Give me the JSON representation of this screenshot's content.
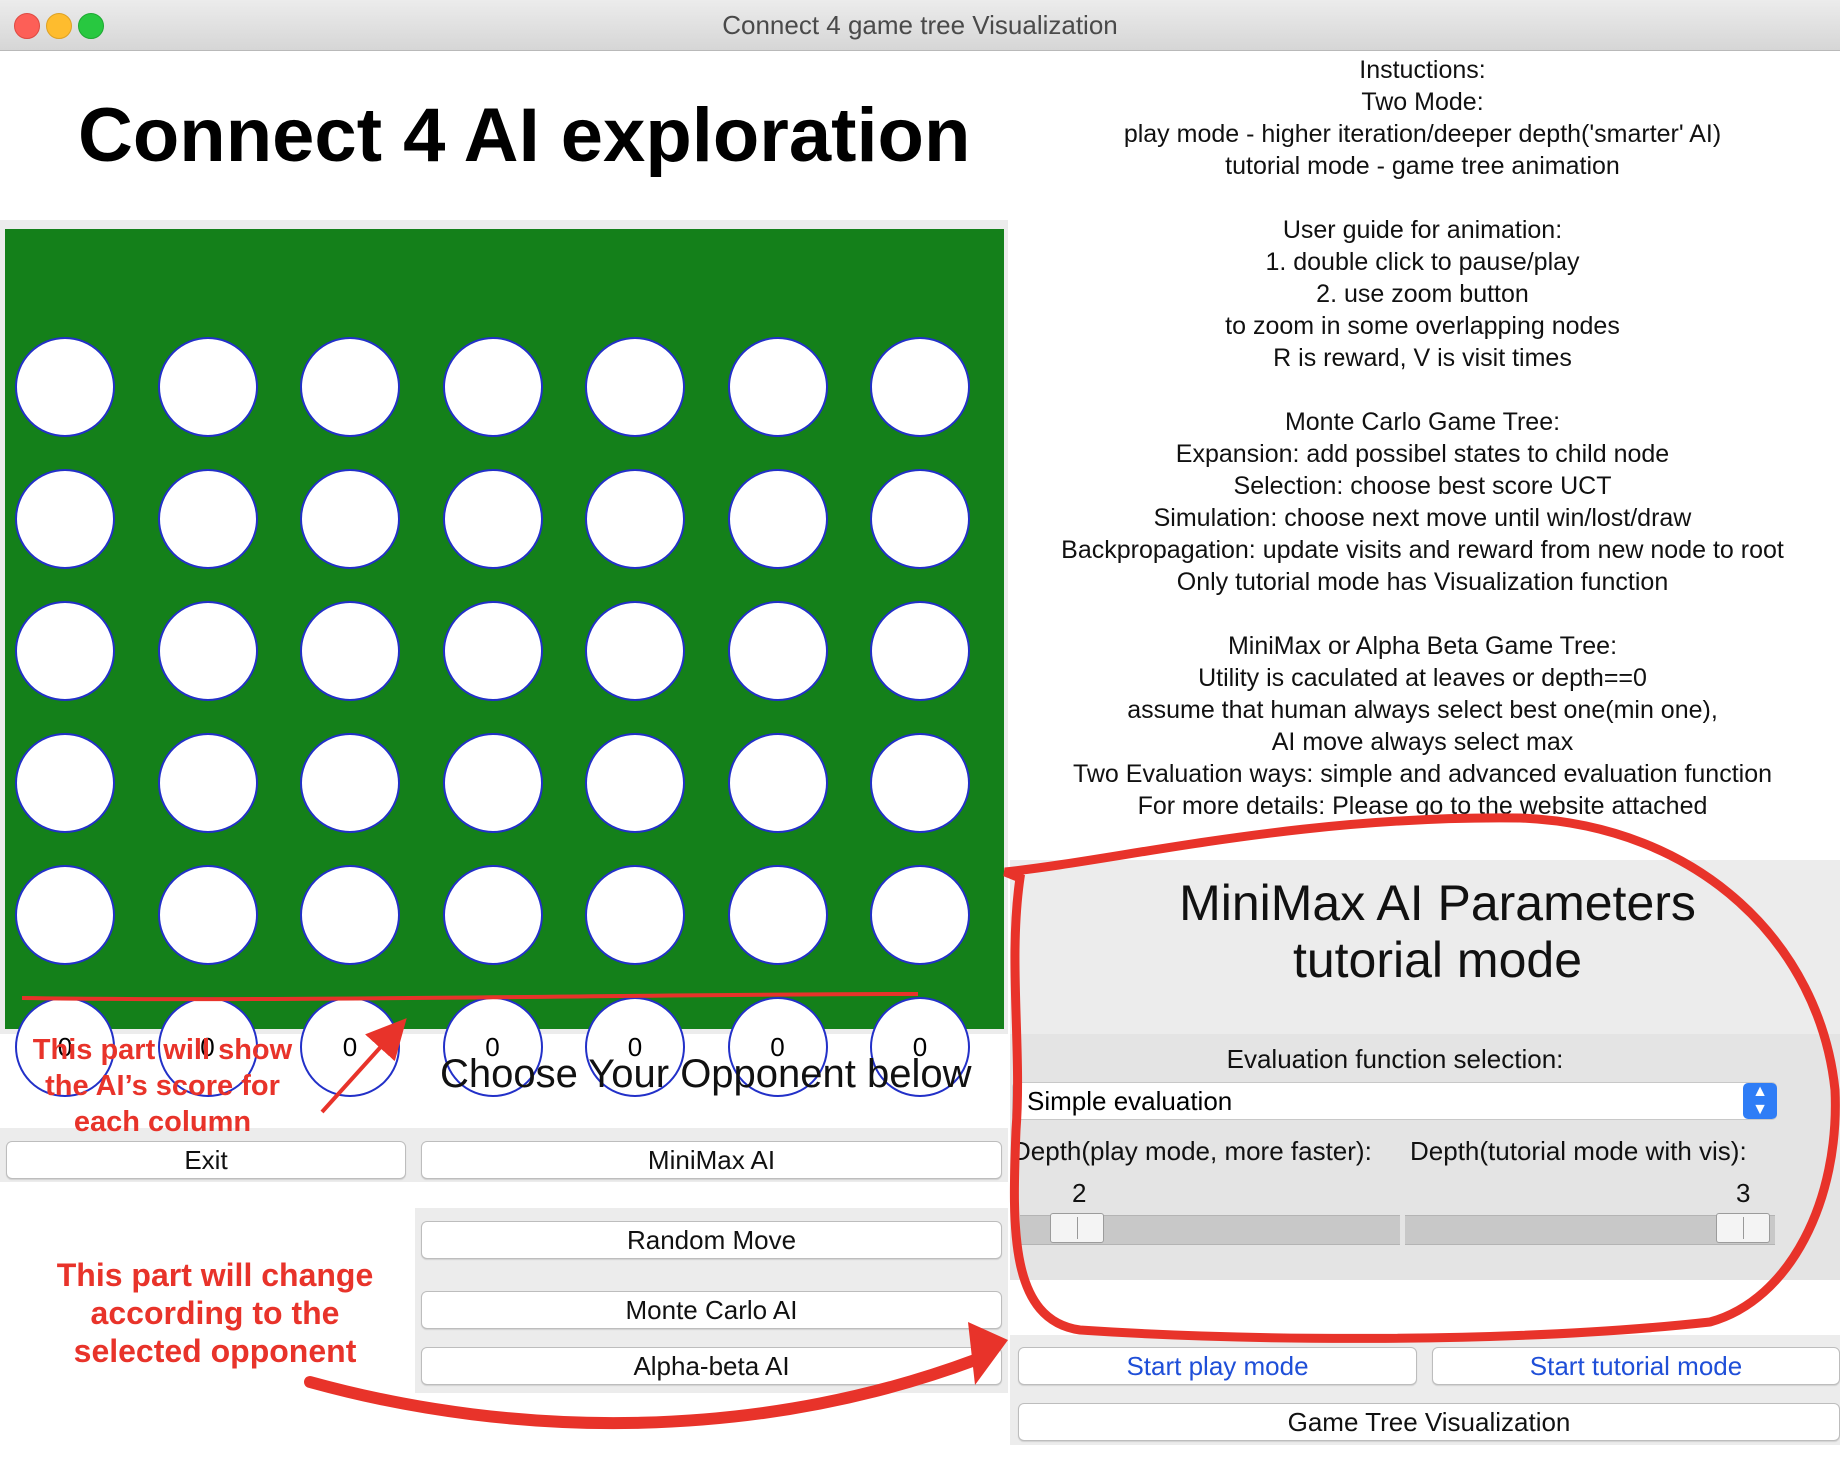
{
  "window": {
    "title": "Connect 4 game tree Visualization"
  },
  "app_title": "Connect 4 AI exploration",
  "board": {
    "rows": 6,
    "cols": 7,
    "column_scores": [
      "0",
      "0",
      "0",
      "0",
      "0",
      "0",
      "0"
    ],
    "colors": {
      "board": "#14801a",
      "cell": "#ffffff",
      "cell_border": "#2230c8"
    }
  },
  "instructions": [
    "Instuctions:",
    "Two Mode:",
    "play mode - higher iteration/deeper depth('smarter' AI)",
    "tutorial mode - game tree animation",
    "",
    "User guide for animation:",
    "1. double click to pause/play",
    "2. use zoom button",
    "to zoom in some overlapping nodes",
    "R is reward, V is visit times",
    "",
    "Monte Carlo Game Tree:",
    "Expansion: add possibel states to child node",
    "Selection: choose best score UCT",
    "Simulation: choose next move until win/lost/draw",
    "Backpropagation: update visits and reward from new node to root",
    "Only tutorial mode has Visualization function",
    "",
    "MiniMax or Alpha Beta Game Tree:",
    "Utility is caculated at leaves or depth==0",
    "assume that human always select best one(min one),",
    "AI move always select max",
    "Two Evaluation ways: simple and advanced evaluation function",
    "For more details: Please go to the website attached"
  ],
  "params": {
    "title_line1": "MiniMax AI Parameters",
    "title_line2": "tutorial mode",
    "eval_label": "Evaluation function selection:",
    "eval_selected": "Simple evaluation",
    "depth_play_label": "Depth(play mode, more faster):",
    "depth_tutorial_label": "Depth(tutorial mode with vis):",
    "depth_play_value": "2",
    "depth_tutorial_value": "3"
  },
  "choose_label": "Choose Your Opponent below",
  "buttons": {
    "exit": "Exit",
    "minimax": "MiniMax AI",
    "random": "Random Move",
    "monte_carlo": "Monte Carlo AI",
    "alpha_beta": "Alpha-beta AI",
    "start_play": "Start play mode",
    "start_tutorial": "Start tutorial mode",
    "game_tree": "Game Tree Visualization"
  },
  "annotations": {
    "score_note": "This part will show the AI’s score for each column",
    "opponent_note": "This part will change according to the selected opponent",
    "color": "#e8332a"
  }
}
